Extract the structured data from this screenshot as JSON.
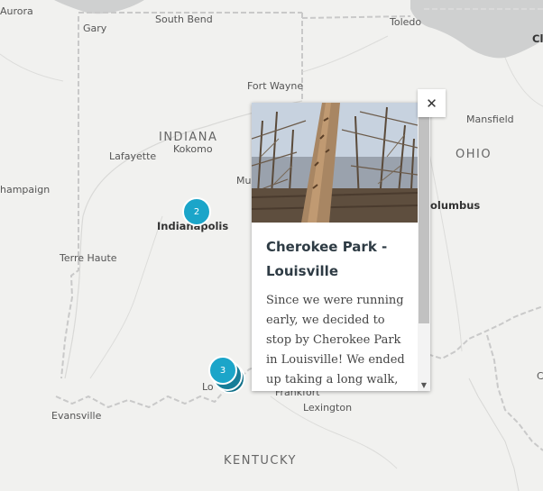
{
  "map": {
    "cities": [
      {
        "id": "aurora",
        "label": "Aurora"
      },
      {
        "id": "gary",
        "label": "Gary"
      },
      {
        "id": "south-bend",
        "label": "South Bend"
      },
      {
        "id": "toledo",
        "label": "Toledo"
      },
      {
        "id": "cl",
        "label": "Cl"
      },
      {
        "id": "fort-wayne",
        "label": "Fort Wayne"
      },
      {
        "id": "mansfield",
        "label": "Mansfield"
      },
      {
        "id": "kokomo",
        "label": "Kokomo"
      },
      {
        "id": "lafayette",
        "label": "Lafayette"
      },
      {
        "id": "mu",
        "label": "Mu"
      },
      {
        "id": "champaign",
        "label": "hampaign"
      },
      {
        "id": "indianapolis",
        "label": "Indianapolis"
      },
      {
        "id": "columbus",
        "label": "olumbus"
      },
      {
        "id": "terre-haute",
        "label": "Terre Haute"
      },
      {
        "id": "louisville",
        "label": "Lo"
      },
      {
        "id": "frankfort",
        "label": "Frankfort"
      },
      {
        "id": "evansville",
        "label": "Evansville"
      },
      {
        "id": "lexington",
        "label": "Lexington"
      },
      {
        "id": "c-right",
        "label": "C"
      }
    ],
    "states": [
      {
        "id": "indiana",
        "label": "INDIANA"
      },
      {
        "id": "ohio",
        "label": "OHIO"
      },
      {
        "id": "kentucky",
        "label": "KENTUCKY"
      }
    ],
    "markers": {
      "indianapolis_count": "2",
      "louisville_count": "3"
    },
    "colors": {
      "land": "#f1f1ef",
      "water": "#cfd0d0",
      "border": "#c9c9c9",
      "marker": "#1ba5c9"
    }
  },
  "popup": {
    "title": "Cherokee Park - Louisville",
    "body": "Since we were running early, we decided to stop by Cherokee Park in Louisville! We ended up taking a long walk,",
    "close_icon": "close-icon",
    "scroll_down_icon": "scroll-down-arrow-icon"
  }
}
